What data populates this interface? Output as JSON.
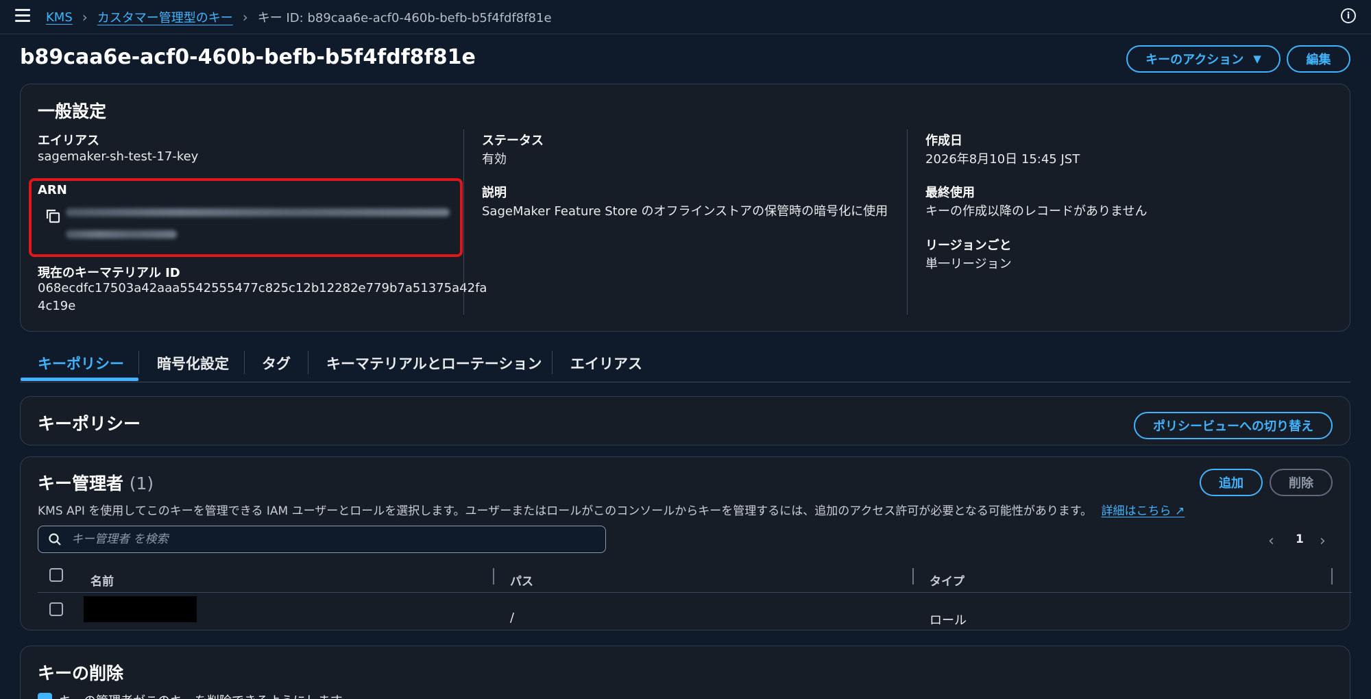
{
  "breadcrumb": {
    "items": [
      "KMS",
      "カスタマー管理型のキー"
    ],
    "current": "キー ID: b89caa6e-acf0-460b-befb-b5f4fdf8f81e"
  },
  "header": {
    "title": "b89caa6e-acf0-460b-befb-b5f4fdf8f81e",
    "key_actions_label": "キーのアクション",
    "edit_label": "編集"
  },
  "general": {
    "title": "一般設定",
    "alias_label": "エイリアス",
    "alias_value": "sagemaker-sh-test-17-key",
    "arn_label": "ARN",
    "material_label": "現在のキーマテリアル ID",
    "material_value_line1": "068ecdfc17503a42aaa5542555477c825c12b12282e779b7a51375a42fa",
    "material_value_line2": "4c19e",
    "status_label": "ステータス",
    "status_value": "有効",
    "description_label": "説明",
    "description_value": "SageMaker Feature Store のオフラインストアの保管時の暗号化に使用",
    "created_label": "作成日",
    "created_value": "2026年8月10日 15:45 JST",
    "last_used_label": "最終使用",
    "last_used_value": "キーの作成以降のレコードがありません",
    "regionality_label": "リージョンごと",
    "regionality_value": "単一リージョン"
  },
  "tabs": [
    "キーポリシー",
    "暗号化設定",
    "タグ",
    "キーマテリアルとローテーション",
    "エイリアス"
  ],
  "policy": {
    "title": "キーポリシー",
    "switch_view_label": "ポリシービューへの切り替え"
  },
  "admins": {
    "title": "キー管理者",
    "count": "(1)",
    "add_label": "追加",
    "delete_label": "削除",
    "description": "KMS API を使用してこのキーを管理できる IAM ユーザーとロールを選択します。ユーザーまたはロールがこのコンソールからキーを管理するには、追加のアクセス許可が必要となる可能性があります。",
    "learn_more": "詳細はこちら",
    "search_placeholder": "キー管理者 を検索",
    "page": "1",
    "columns": [
      "名前",
      "パス",
      "タイプ"
    ],
    "rows": [
      {
        "path": "/",
        "type": "ロール"
      }
    ]
  },
  "deletion": {
    "title": "キーの削除",
    "checkbox_label": "キーの管理者がこのキーを削除できるようにします。"
  }
}
